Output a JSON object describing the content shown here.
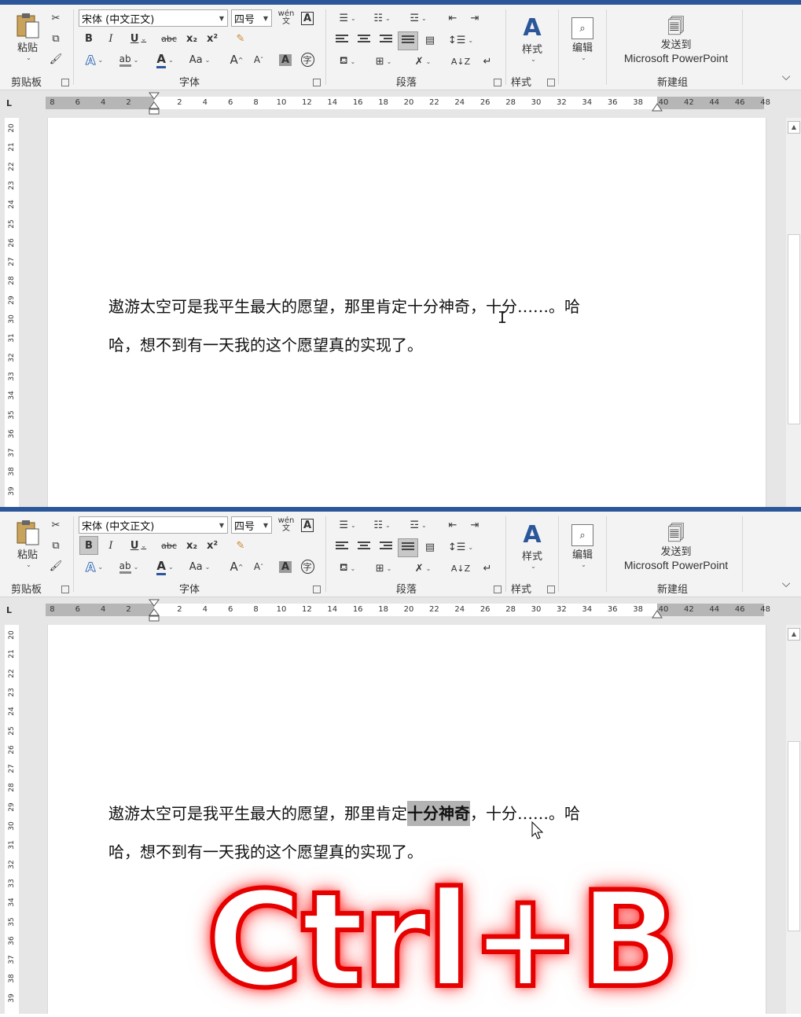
{
  "ribbon": {
    "clipboard": {
      "paste_label": "粘贴",
      "group_label": "剪贴板"
    },
    "font": {
      "font_name": "宋体 (中文正文)",
      "font_size": "四号",
      "phonetic_label": "wén",
      "group_label": "字体",
      "bold_label": "B",
      "italic_label": "I",
      "underline_label": "U",
      "strike_label": "abc",
      "subscript_label": "x₂",
      "superscript_label": "x²",
      "case_label": "Aa",
      "grow_label": "A",
      "shrink_label": "A",
      "charshade_label": "A",
      "enclose_label": "字",
      "border_label": "A",
      "fontcolor_label": "A",
      "textfx_label": "A",
      "highlight_label": "ab"
    },
    "paragraph": {
      "group_label": "段落",
      "sort_label": "A↓Z"
    },
    "styles": {
      "label": "样式",
      "group_label": "样式"
    },
    "editing": {
      "label": "编辑"
    },
    "send": {
      "line1": "发送到",
      "line2": "Microsoft PowerPoint",
      "group_label": "新建组"
    }
  },
  "ruler": {
    "corner": "L",
    "ticks_left": [
      "8",
      "6",
      "4",
      "2"
    ],
    "ticks_right": [
      "2",
      "4",
      "6",
      "8",
      "10",
      "12",
      "14",
      "16",
      "18",
      "20",
      "22",
      "24",
      "26",
      "28",
      "30",
      "32",
      "34",
      "36",
      "38",
      "40",
      "42",
      "44",
      "46",
      "48"
    ],
    "vertical_ticks": [
      "20",
      "21",
      "22",
      "23",
      "24",
      "25",
      "26",
      "27",
      "28",
      "29",
      "30",
      "31",
      "32",
      "33",
      "34",
      "35",
      "36",
      "37",
      "38",
      "39"
    ]
  },
  "document": {
    "line1_before": "遨游太空可是我平生最大的愿望，那里肯定",
    "selected": "十分神奇",
    "line1_after": "，十分……。哈",
    "line2": "哈，想不到有一天我的这个愿望真的实现了。"
  },
  "overlay": {
    "shortcut": "Ctrl+B"
  },
  "colors": {
    "accent": "#2b579a",
    "selection": "#b3b3b3",
    "overlay_stroke": "#e60000"
  }
}
